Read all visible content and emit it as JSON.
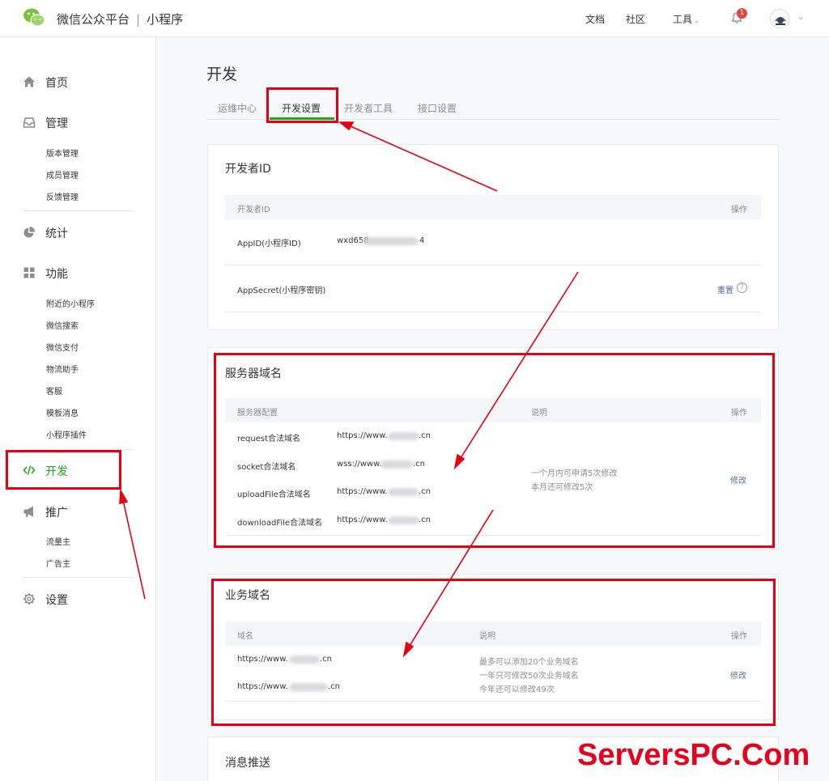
{
  "header": {
    "brand": "微信公众平台",
    "product": "小程序",
    "nav": {
      "docs": "文档",
      "community": "社区",
      "tools": "工具"
    },
    "notification_count": "1"
  },
  "sidebar": {
    "home": "首页",
    "manage": "管理",
    "manage_items": [
      "版本管理",
      "成员管理",
      "反馈管理"
    ],
    "stats": "统计",
    "features": "功能",
    "feature_items": [
      "附近的小程序",
      "微信搜索",
      "微信支付",
      "物流助手",
      "客服",
      "模板消息",
      "小程序插件"
    ],
    "develop": "开发",
    "promote": "推广",
    "promote_items": [
      "流量主",
      "广告主"
    ],
    "settings": "设置"
  },
  "main": {
    "title": "开发",
    "tabs": [
      "运维中心",
      "开发设置",
      "开发者工具",
      "接口设置"
    ],
    "developer_id": {
      "title": "开发者ID",
      "col_id": "开发者ID",
      "col_action": "操作",
      "appid_label": "AppID(小程序ID)",
      "appid_value": "wxd658",
      "appid_tail": "4",
      "secret_label": "AppSecret(小程序密钥)",
      "reset": "重置",
      "help": "?"
    },
    "server_domain": {
      "title": "服务器域名",
      "col_config": "服务器配置",
      "col_desc": "说明",
      "col_action": "操作",
      "rows": [
        {
          "label": "request合法域名",
          "prefix": "https://www.",
          "suffix": ".cn"
        },
        {
          "label": "socket合法域名",
          "prefix": "wss://www.",
          "suffix": ".cn"
        },
        {
          "label": "uploadFile合法域名",
          "prefix": "https://www.",
          "suffix": ".cn"
        },
        {
          "label": "downloadFile合法域名",
          "prefix": "https://www.",
          "suffix": ".cn"
        }
      ],
      "desc_lines": [
        "一个月内可申请5次修改",
        "本月还可修改5次"
      ],
      "modify": "修改"
    },
    "business_domain": {
      "title": "业务域名",
      "col_domain": "域名",
      "col_desc": "说明",
      "col_action": "操作",
      "rows": [
        {
          "prefix": "https://www.",
          "suffix": ".cn"
        },
        {
          "prefix": "https://www.",
          "suffix": ".cn"
        }
      ],
      "desc_lines": [
        "最多可以添加20个业务域名",
        "一年只可修改50次业务域名",
        "今年还可以修改49次"
      ],
      "modify": "修改"
    },
    "message_push": {
      "title": "消息推送"
    }
  },
  "watermark": "ServersPC.Com",
  "colors": {
    "accent_green": "#1aad19",
    "annotation_red": "#e60012",
    "link_blue": "#576b95"
  }
}
